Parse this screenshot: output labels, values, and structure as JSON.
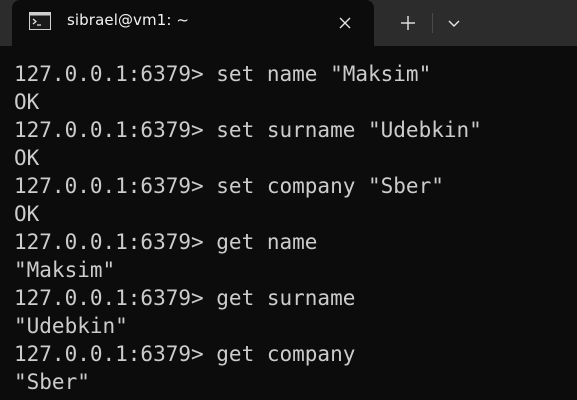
{
  "window": {
    "tab_title": "sibrael@vm1: ~",
    "tab_icon": "terminal-icon",
    "close_icon": "close-icon",
    "new_tab_icon": "plus-icon",
    "dropdown_icon": "chevron-down-icon"
  },
  "terminal": {
    "lines": [
      "127.0.0.1:6379> set name \"Maksim\"",
      "OK",
      "127.0.0.1:6379> set surname \"Udebkin\"",
      "OK",
      "127.0.0.1:6379> set company \"Sber\"",
      "OK",
      "127.0.0.1:6379> get name",
      "\"Maksim\"",
      "127.0.0.1:6379> get surname",
      "\"Udebkin\"",
      "127.0.0.1:6379> get company",
      "\"Sber\""
    ]
  },
  "colors": {
    "background": "#0c0c0c",
    "titlebar": "#2c2c2c",
    "text": "#cccccc"
  }
}
